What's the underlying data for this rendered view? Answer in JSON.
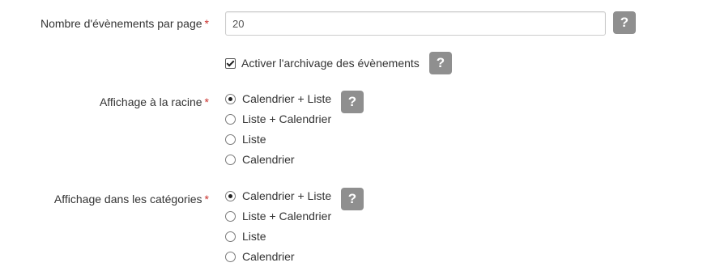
{
  "form": {
    "events_per_page": {
      "label": "Nombre d'évènements par page",
      "required_mark": "*",
      "value": "20",
      "help": "?"
    },
    "archive": {
      "label": "Activer l'archivage des évènements",
      "checked": true,
      "help": "?"
    },
    "root_display": {
      "label": "Affichage à la racine",
      "required_mark": "*",
      "help": "?",
      "options": [
        {
          "label": "Calendrier + Liste",
          "selected": true
        },
        {
          "label": "Liste + Calendrier",
          "selected": false
        },
        {
          "label": "Liste",
          "selected": false
        },
        {
          "label": "Calendrier",
          "selected": false
        }
      ]
    },
    "category_display": {
      "label": "Affichage dans les catégories",
      "required_mark": "*",
      "help": "?",
      "options": [
        {
          "label": "Calendrier + Liste",
          "selected": true
        },
        {
          "label": "Liste + Calendrier",
          "selected": false
        },
        {
          "label": "Liste",
          "selected": false
        },
        {
          "label": "Calendrier",
          "selected": false
        }
      ]
    }
  },
  "colors": {
    "required": "#c9302c",
    "help_bg": "#8f8f8f",
    "text": "#333333"
  },
  "icons": {
    "help": "question-mark",
    "radio": "radio-button",
    "checkbox": "checkbox"
  }
}
